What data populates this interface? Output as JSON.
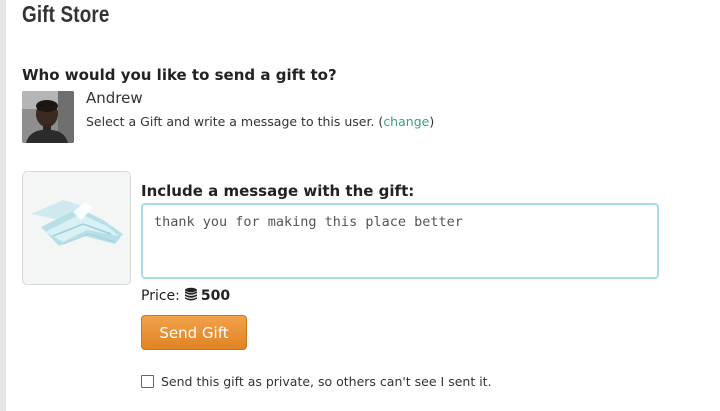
{
  "page": {
    "title": "Gift Store"
  },
  "recipient": {
    "question": "Who would you like to send a gift to?",
    "name": "Andrew",
    "instruction": "Select a Gift and write a message to this user. (",
    "change_label": "change",
    "instruction_end": ")"
  },
  "message": {
    "label": "Include a message with the gift:",
    "value": "thank you for making this place better"
  },
  "price": {
    "label": "Price:",
    "amount": "500",
    "icon": "coins-icon"
  },
  "actions": {
    "send_label": "Send Gift",
    "private_label": "Send this gift as private, so others can't see I sent it.",
    "private_checked": false
  },
  "colors": {
    "accent_orange": "#e08423",
    "link_teal": "#3a9b8a",
    "input_border": "#a9dcea"
  }
}
